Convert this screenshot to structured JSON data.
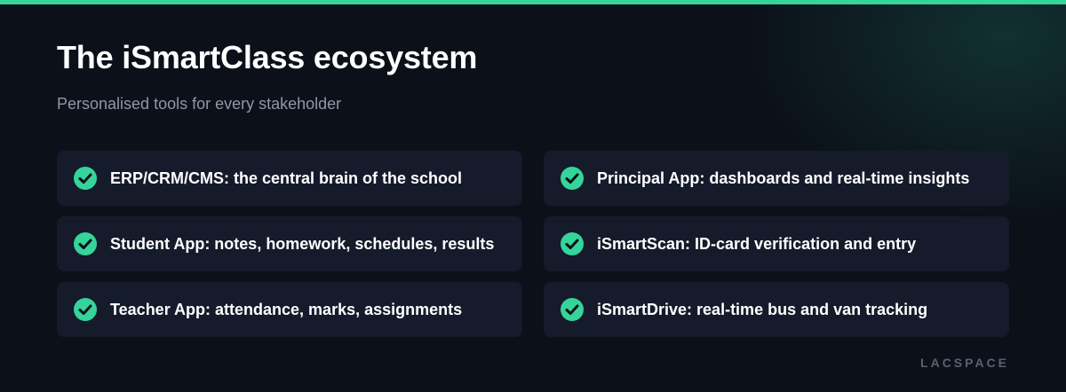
{
  "header": {
    "title": "The iSmartClass ecosystem",
    "subtitle": "Personalised tools for every stakeholder"
  },
  "features": [
    {
      "label": "ERP/CRM/CMS: the central brain of the school",
      "icon": "check-circle-icon"
    },
    {
      "label": "Principal App: dashboards and real-time insights",
      "icon": "check-circle-icon"
    },
    {
      "label": "Student App: notes, homework, schedules, results",
      "icon": "check-circle-icon"
    },
    {
      "label": "iSmartScan: ID-card verification and entry",
      "icon": "check-circle-icon"
    },
    {
      "label": "Teacher App: attendance, marks, assignments",
      "icon": "check-circle-icon"
    },
    {
      "label": "iSmartDrive: real-time bus and van tracking",
      "icon": "check-circle-icon"
    }
  ],
  "footer": {
    "brand": "LACSPACE"
  },
  "colors": {
    "accent": "#35d49a",
    "background": "#0b1019",
    "card": "#151b2b",
    "subtitle": "#8f98a6"
  }
}
